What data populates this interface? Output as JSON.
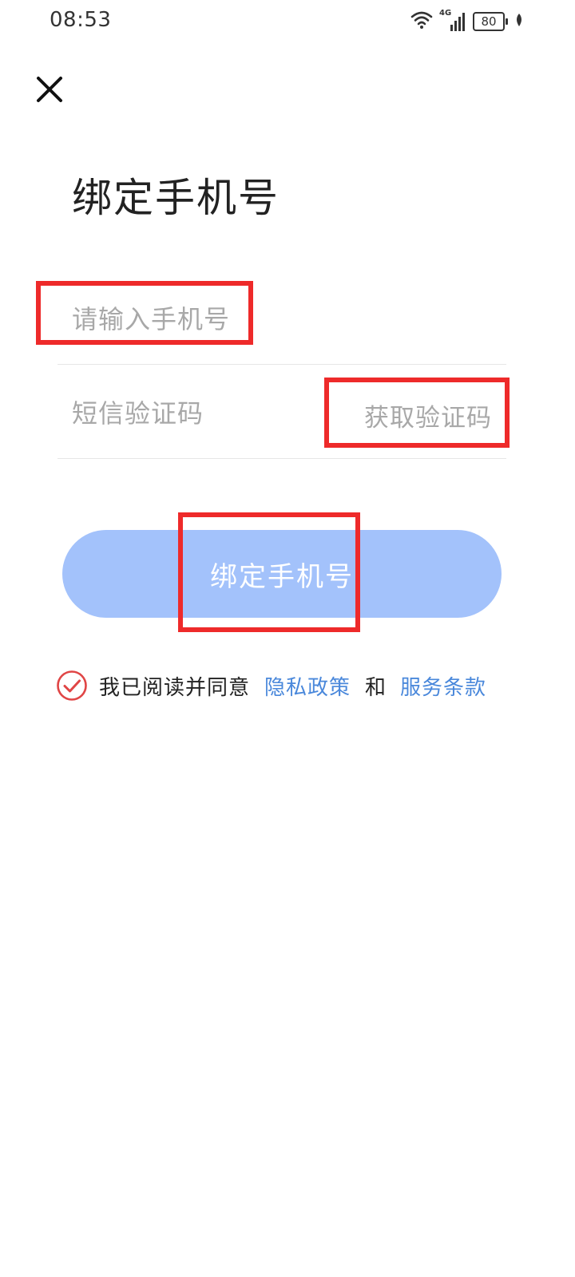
{
  "status_bar": {
    "time": "08:53",
    "network": "4G",
    "battery": "80"
  },
  "header": {
    "close_icon": "close-icon",
    "title": "绑定手机号"
  },
  "form": {
    "phone_placeholder": "请输入手机号",
    "sms_placeholder": "短信验证码",
    "get_code_label": "获取验证码",
    "submit_label": "绑定手机号"
  },
  "agreement": {
    "checked": true,
    "prefix": "我已阅读并同意",
    "privacy_link": "隐私政策",
    "conjunction": "和",
    "terms_link": "服务条款"
  },
  "colors": {
    "button_bg": "#a3c2fb",
    "link": "#4a88db",
    "check": "#e04545",
    "highlight": "#ee2a2a"
  }
}
